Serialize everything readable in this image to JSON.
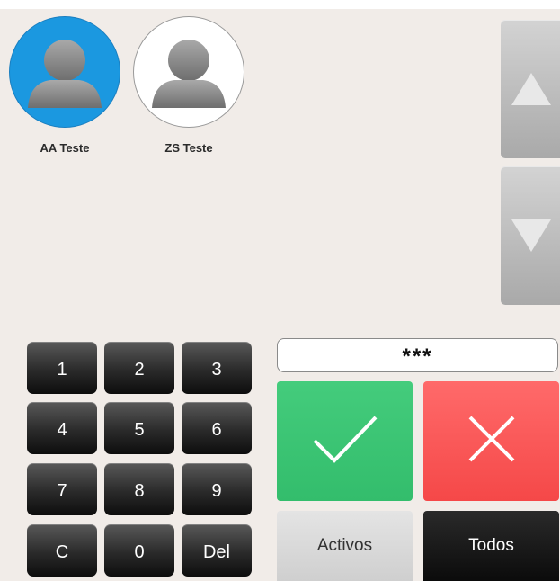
{
  "users": [
    {
      "name": "AA Teste",
      "selected": true,
      "icon": "user-avatar-icon"
    },
    {
      "name": "ZS Teste",
      "selected": false,
      "icon": "user-avatar-icon"
    }
  ],
  "scroll": {
    "up_icon": "triangle-up-icon",
    "down_icon": "triangle-down-icon"
  },
  "keypad": [
    "1",
    "2",
    "3",
    "4",
    "5",
    "6",
    "7",
    "8",
    "9",
    "C",
    "0",
    "Del"
  ],
  "pin": {
    "masked_value": "***"
  },
  "actions": {
    "confirm_icon": "checkmark-icon",
    "cancel_icon": "close-icon"
  },
  "filters": {
    "active_label": "Activos",
    "all_label": "Todos"
  },
  "colors": {
    "selected_user": "#1b98e0",
    "confirm": "#3dc574",
    "cancel": "#f85656",
    "keypad": "#222222"
  }
}
